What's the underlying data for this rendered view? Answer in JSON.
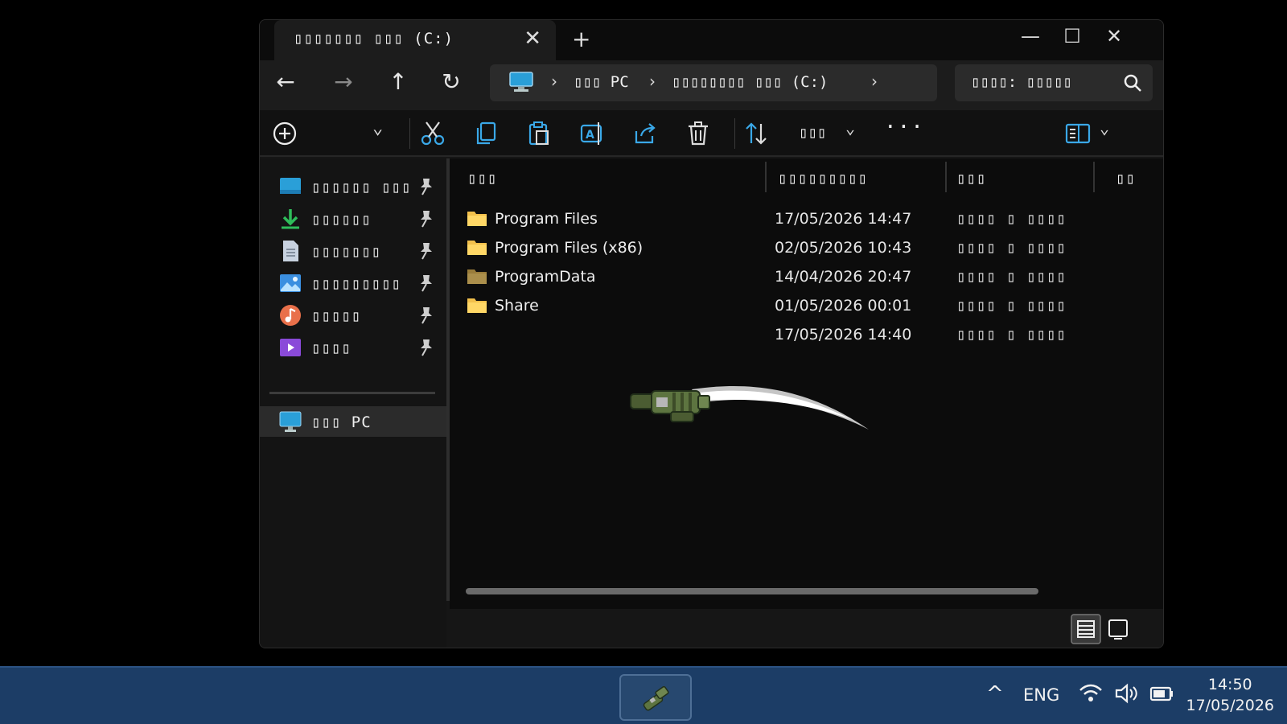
{
  "window": {
    "tab_title": "▯▯▯▯▯▯▯ ▯▯▯ (C:)",
    "tab_close": "✕",
    "new_tab": "+",
    "minimize": "—",
    "maximize": "☐",
    "close": "✕"
  },
  "nav": {
    "back": "←",
    "forward": "→",
    "up": "↑",
    "refresh": "↻",
    "breadcrumb": [
      "▯▯▯ PC",
      "▯▯▯▯▯▯▯▯ ▯▯▯ (C:)"
    ],
    "chevron": "›",
    "search_placeholder": "▯▯▯▯: ▯▯▯▯▯"
  },
  "toolbar": {
    "new_dropdown": "⌄",
    "sort_label": "▯▯▯",
    "sort_chevron": "⌄",
    "more": "···",
    "view_chevron": "⌄"
  },
  "sidebar": {
    "items": [
      {
        "label": "▯▯▯▯▯▯ ▯▯▯",
        "icon": "desktop-icon",
        "color": "#2a9fd8"
      },
      {
        "label": "▯▯▯▯▯▯",
        "icon": "download-icon",
        "color": "#2ebd5a"
      },
      {
        "label": "▯▯▯▯▯▯▯",
        "icon": "document-icon",
        "color": "#c8d2e0"
      },
      {
        "label": "▯▯▯▯▯▯▯▯▯",
        "icon": "pictures-icon",
        "color": "#3b8fe0"
      },
      {
        "label": "▯▯▯▯▯",
        "icon": "music-icon",
        "color": "#e9704a"
      },
      {
        "label": "▯▯▯▯",
        "icon": "videos-icon",
        "color": "#8a4ad9"
      }
    ],
    "this_pc": "▯▯▯ PC"
  },
  "columns": {
    "name": "▯▯▯",
    "date": "▯▯▯▯▯▯▯▯▯",
    "type": "▯▯▯",
    "size": "▯▯"
  },
  "files": [
    {
      "name": "Program Files",
      "date": "17/05/2026 14:47",
      "type": "▯▯▯▯ ▯ ▯▯▯▯",
      "folder": true
    },
    {
      "name": "Program Files (x86)",
      "date": "02/05/2026 10:43",
      "type": "▯▯▯▯ ▯ ▯▯▯▯",
      "folder": true
    },
    {
      "name": "ProgramData",
      "date": "14/04/2026 20:47",
      "type": "▯▯▯▯ ▯ ▯▯▯▯",
      "folder": true
    },
    {
      "name": "Share",
      "date": "01/05/2026 00:01",
      "type": "▯▯▯▯ ▯ ▯▯▯▯",
      "folder": true
    },
    {
      "name": "",
      "date": "17/05/2026 14:40",
      "type": "▯▯▯▯ ▯ ▯▯▯▯",
      "folder": false
    }
  ],
  "taskbar": {
    "tray_chevron": "^",
    "language": "ENG",
    "time": "14:50",
    "date": "17/05/2026"
  },
  "colors": {
    "accent": "#2a9fd8",
    "folder": "#f2c04c",
    "taskbar": "#1c3d66",
    "weapon": "#5d7440"
  }
}
